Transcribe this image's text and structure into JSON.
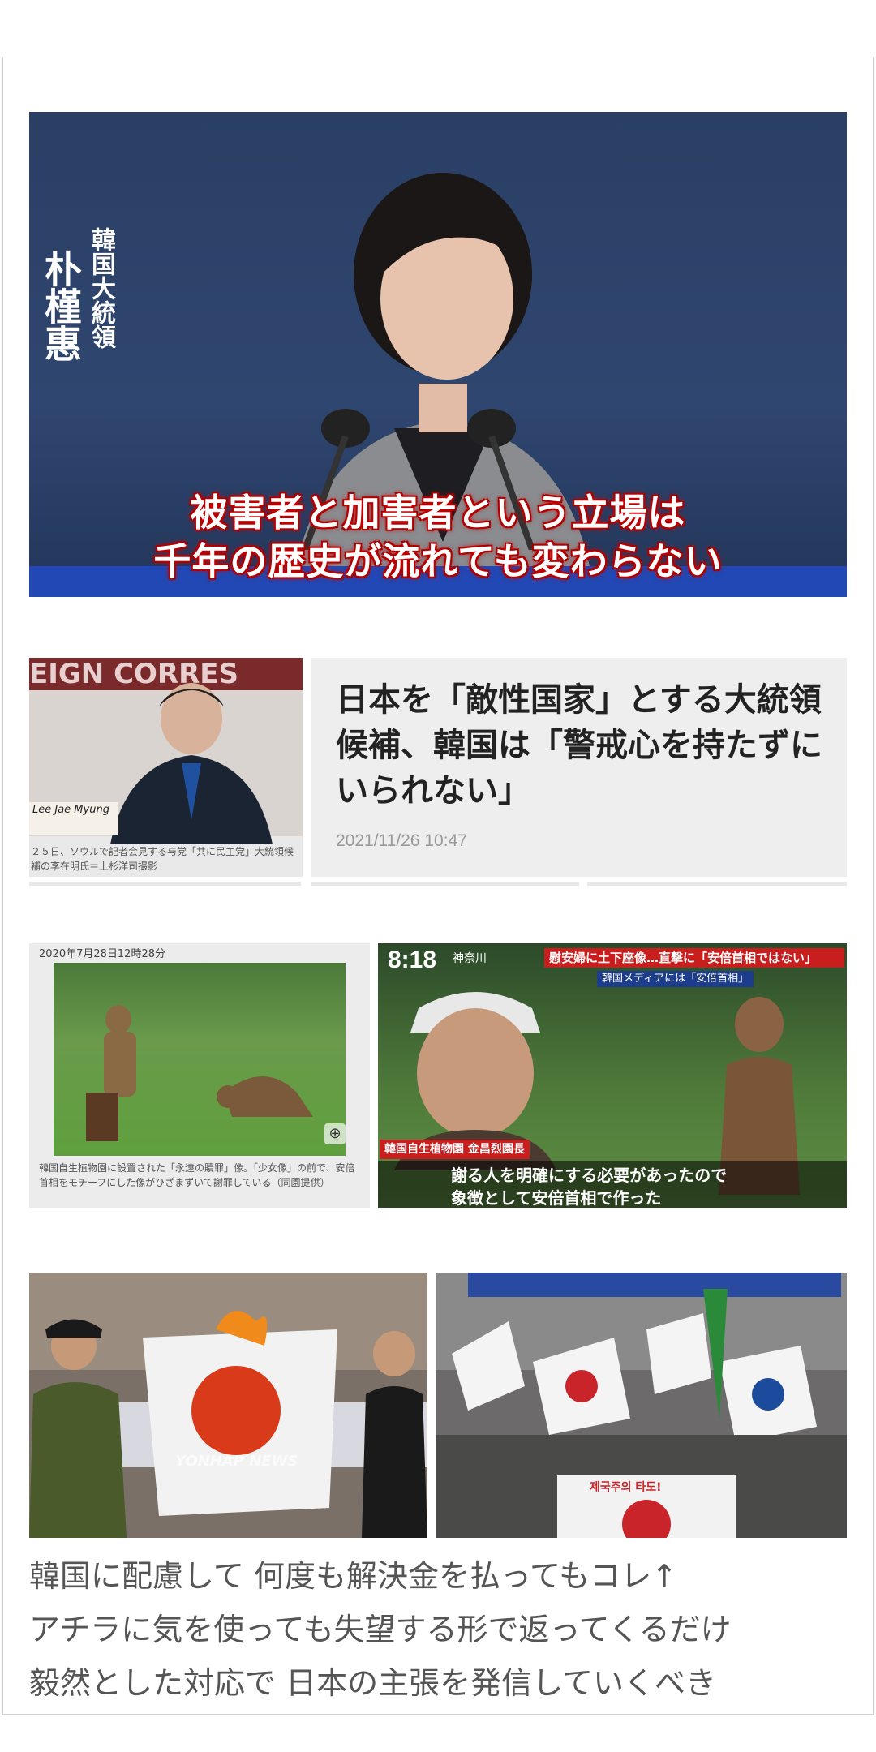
{
  "main_image": {
    "name_label": "朴槿惠",
    "title_label": "韓国大統領",
    "caption_line1": "被害者と加害者という立場は",
    "caption_line2": "千年の歴史が流れても変わらない"
  },
  "article": {
    "image_caption": "２５日、ソウルで記者会見する与党「共に民主党」大統領候補の李在明氏＝上杉洋司撮影",
    "image_banner": "EIGN CORRES",
    "image_nameplate": "Lee Jae Myung",
    "headline": "日本を「敵性国家」とする大統領候補、韓国は「警戒心を持たずにいられない」",
    "date": "2021/11/26 10:47"
  },
  "statue_images": {
    "left_date": "2020年7月28日12時28分",
    "left_caption": "韓国自生植物園に設置された「永遠の贖罪」像。「少女像」の前で、安倍首相をモチーフにした像がひざまずいて謝罪している（同園提供）",
    "right_time": "8:18",
    "right_location": "神奈川",
    "right_headline": "慰安婦に土下座像…直撃に「安倍首相ではない」",
    "right_subhead": "韓国メディアには「安倍首相」",
    "right_name_tag": "韓国自生植物園 金昌烈園長",
    "right_caption_line1": "謝る人を明確にする必要があったので",
    "right_caption_line2": "象徴として安倍首相で作った"
  },
  "protest_images": {
    "left_watermark": "YONHAP NEWS",
    "right_banner": "제국주의 타도!"
  },
  "comment": {
    "line1": "韓国に配慮して 何度も解決金を払ってもコレ↑",
    "line2": "アチラに気を使っても失望する形で返ってくるだけ",
    "line3": "毅然とした対応で 日本の主張を発信していくべき"
  }
}
